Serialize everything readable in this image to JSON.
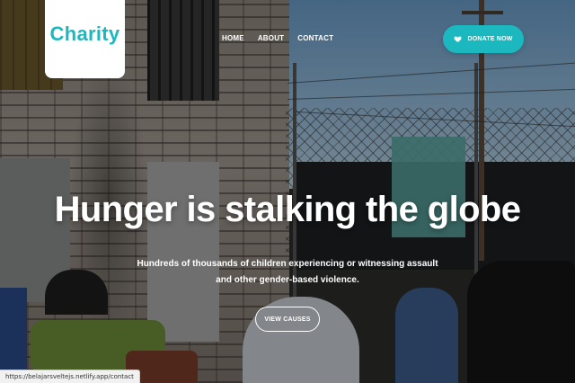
{
  "logo": {
    "text": "Charity"
  },
  "nav": {
    "items": [
      {
        "label": "HOME"
      },
      {
        "label": "ABOUT"
      },
      {
        "label": "CONTACT"
      }
    ]
  },
  "donate_button": {
    "label": "DONATE NOW",
    "icon": "heart-icon"
  },
  "hero": {
    "headline": "Hunger is stalking the globe",
    "subtext_line1": "Hundreds of thousands of children experiencing or witnessing assault",
    "subtext_line2": "and other gender-based violence.",
    "cta_label": "VIEW CAUSES"
  },
  "status_bar": {
    "url": "https://belajarsveltejs.netlify.app/contact"
  },
  "colors": {
    "accent": "#1cb8bf",
    "white": "#ffffff"
  }
}
